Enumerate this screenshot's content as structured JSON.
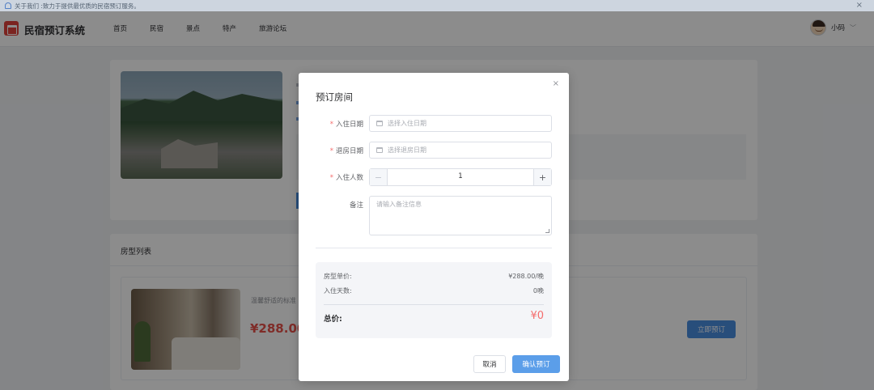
{
  "notice": {
    "text": "关于我们 :致力于提供最优质的民宿预订服务。",
    "close_icon": "×"
  },
  "header": {
    "logo_text": "民宿预订系统",
    "nav": [
      "首页",
      "民宿",
      "景点",
      "特产",
      "旅游论坛"
    ],
    "user_name": "小码",
    "user_chevron": "﹀"
  },
  "background": {
    "room_list_title": "房型列表",
    "room_desc": "温馨舒适的标准",
    "room_price": "¥288.00",
    "book_now": "立即预订"
  },
  "dialog": {
    "title": "预订房间",
    "close_icon": "×",
    "required_mark": "*",
    "checkin_label": "入住日期",
    "checkin_placeholder": "选择入住日期",
    "checkout_label": "退房日期",
    "checkout_placeholder": "选择退房日期",
    "guests_label": "入住人数",
    "guests_value": "1",
    "minus": "−",
    "plus": "+",
    "remark_label": "备注",
    "remark_placeholder": "请输入备注信息",
    "unit_price_label": "房型单价:",
    "unit_price_value": "¥288.00/晚",
    "nights_label": "入住天数:",
    "nights_value": "0晚",
    "total_label": "总价:",
    "total_value": "¥0",
    "cancel": "取消",
    "confirm": "确认预订"
  },
  "colors": {
    "primary": "#5b9ee9",
    "danger": "#f56c6c",
    "logo": "#e0423b"
  }
}
